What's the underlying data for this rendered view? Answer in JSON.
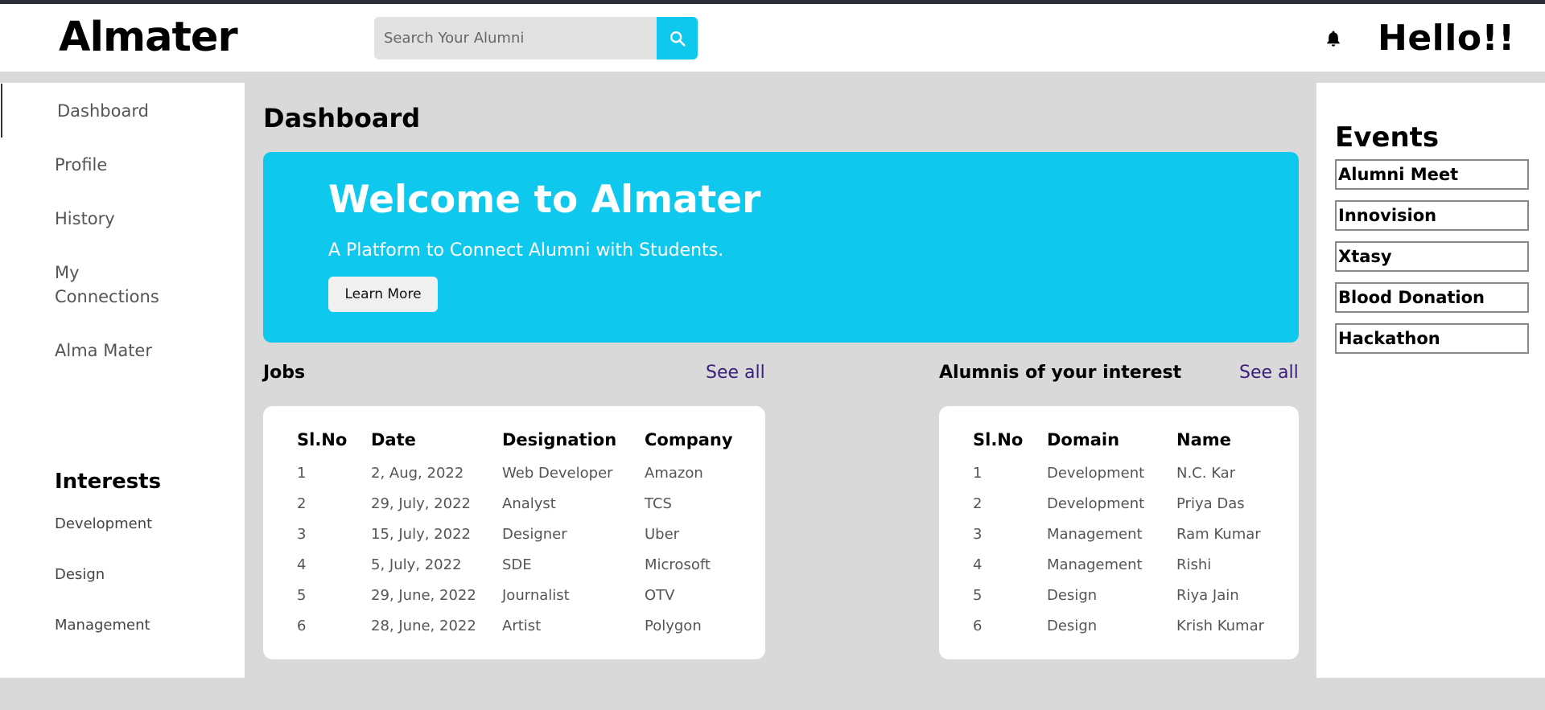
{
  "header": {
    "logo": "Almater",
    "search_placeholder": "Search Your Alumni",
    "greeting": "Hello!!",
    "icons": {
      "search": "search-icon",
      "notifications": "bell-icon"
    }
  },
  "sidebar": {
    "items": [
      {
        "label": "Dashboard"
      },
      {
        "label": "Profile"
      },
      {
        "label": "History"
      },
      {
        "label": "My Connections"
      },
      {
        "label": "Alma Mater"
      }
    ],
    "interests_title": "Interests",
    "interests": [
      "Development",
      "Design",
      "Management"
    ]
  },
  "main": {
    "title": "Dashboard",
    "banner": {
      "title": "Welcome to Almater",
      "subtitle": "A Platform to Connect Alumni with Students.",
      "button": "Learn More"
    },
    "jobs": {
      "title": "Jobs",
      "see_all": "See all",
      "columns": [
        "Sl.No",
        "Date",
        "Designation",
        "Company"
      ],
      "rows": [
        [
          "1",
          "2, Aug, 2022",
          "Web Developer",
          "Amazon"
        ],
        [
          "2",
          "29, July, 2022",
          "Analyst",
          "TCS"
        ],
        [
          "3",
          "15, July, 2022",
          "Designer",
          "Uber"
        ],
        [
          "4",
          "5, July, 2022",
          "SDE",
          "Microsoft"
        ],
        [
          "5",
          "29, June, 2022",
          "Journalist",
          "OTV"
        ],
        [
          "6",
          "28, June, 2022",
          "Artist",
          "Polygon"
        ]
      ]
    },
    "alumni": {
      "title": "Alumnis of your interest",
      "see_all": "See all",
      "columns": [
        "Sl.No",
        "Domain",
        "Name"
      ],
      "rows": [
        [
          "1",
          "Development",
          "N.C. Kar"
        ],
        [
          "2",
          "Development",
          "Priya Das"
        ],
        [
          "3",
          "Management",
          "Ram Kumar"
        ],
        [
          "4",
          "Management",
          "Rishi"
        ],
        [
          "5",
          "Design",
          "Riya Jain"
        ],
        [
          "6",
          "Design",
          "Krish Kumar"
        ]
      ]
    }
  },
  "events": {
    "title": "Events",
    "items": [
      "Alumni Meet",
      "Innovision",
      "Xtasy",
      "Blood Donation",
      "Hackathon"
    ]
  },
  "colors": {
    "accent": "#0fc8ee",
    "link": "#3b1f7a",
    "background": "#d9d9d9",
    "topbar": "#2b2d36"
  }
}
